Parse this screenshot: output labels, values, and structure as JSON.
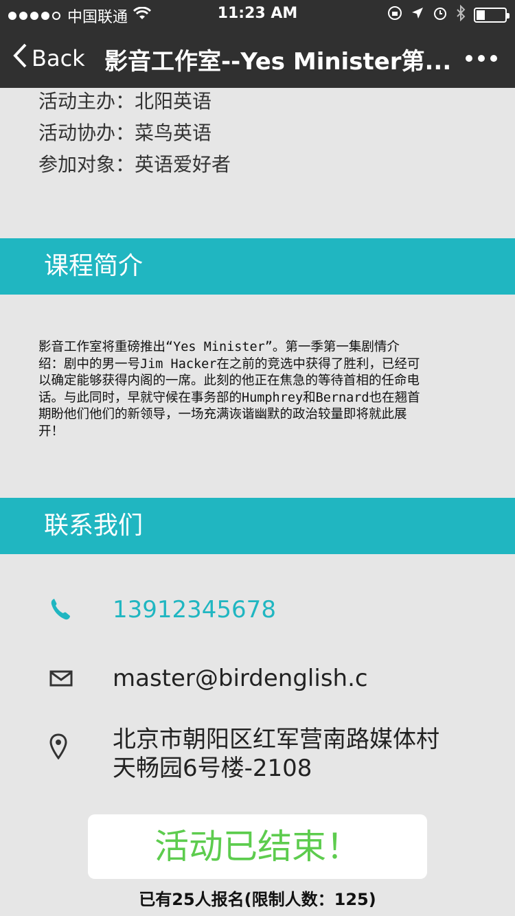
{
  "status_bar": {
    "carrier": "中国联通",
    "time": "11:23 AM"
  },
  "nav": {
    "back_label": "Back",
    "title": "影音工作室--Yes Minister第..."
  },
  "info": [
    "活动主办：北阳英语",
    "活动协办：菜鸟英语",
    "参加对象：英语爱好者"
  ],
  "sections": {
    "intro_title": "课程简介",
    "contact_title": "联系我们"
  },
  "intro_lines": [
    "影音工作室将重磅推出“Yes Minister”。第一季第一集剧情介",
    "绍：剧中的男一号Jim Hacker在之前的竞选中获得了胜利，已经可",
    "以确定能够获得内阁的一席。此刻的他正在焦急的等待首相的任命电",
    "话。与此同时，早就守候在事务部的Humphrey和Bernard也在翘首",
    "期盼他们他们的新领导，一场充满诙谐幽默的政治较量即将就此展",
    "开！"
  ],
  "contact": {
    "phone": "13912345678",
    "email": "master@birdenglish.c",
    "address_line1": "北京市朝阳区红军营南路媒体村",
    "address_line2": "天畅园6号楼-2108"
  },
  "end_button_label": "活动已结束！",
  "signup_info": "已有25人报名(限制人数：125)",
  "colors": {
    "accent": "#20b6c1",
    "button_text": "#5dcc4e",
    "bar": "#303030",
    "background": "#e6e6e6"
  }
}
